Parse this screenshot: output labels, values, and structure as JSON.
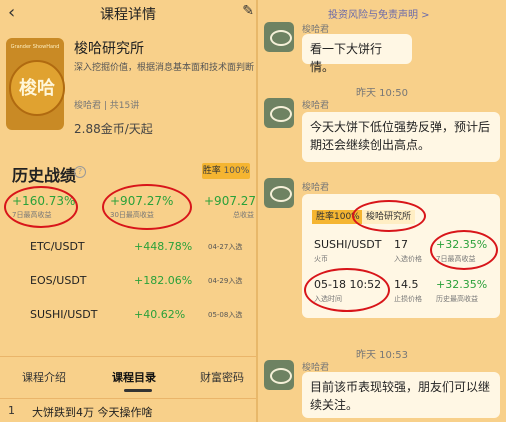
{
  "left": {
    "header": {
      "back_icon": "chevron-left-icon",
      "title": "课程详情",
      "share_icon": "edit-icon"
    },
    "institute": {
      "logo_text": "梭哈",
      "logo_en": "Grander ShowHand",
      "name": "梭哈研究所",
      "description": "深入挖掘价值，根据消息基本面和技术面判断现货数字货币走势，通过优化达",
      "meta": "梭哈君 | 共15讲",
      "price": "2.88金币/天起"
    },
    "record": {
      "title": "历史战绩",
      "win_label": "胜率",
      "win_rate": "100%",
      "stats": [
        {
          "value": "+160.73%",
          "label": "7日最高收益"
        },
        {
          "value": "+907.27%",
          "label": "30日最高收益"
        },
        {
          "value": "+907.27%",
          "label": "总收益"
        }
      ],
      "rows": [
        {
          "symbol": "ETC/USDT",
          "gain": "+448.78%",
          "date": "04-27入选"
        },
        {
          "symbol": "EOS/USDT",
          "gain": "+182.06%",
          "date": "04-29入选"
        },
        {
          "symbol": "SUSHI/USDT",
          "gain": "+40.62%",
          "date": "05-08入选"
        }
      ]
    },
    "tabs": [
      "课程介绍",
      "课程目录",
      "财富密码"
    ],
    "active_tab": "课程目录",
    "first_lesson": {
      "num": "1",
      "title": "大饼跌到4万 今天操作啥"
    }
  },
  "right": {
    "disclaimer": "投资风险与免责声明 >",
    "messages": [
      {
        "sender": "梭哈君",
        "text": "看一下大饼行情。"
      },
      {
        "timestamp": "昨天 10:50"
      },
      {
        "sender": "梭哈君",
        "text": "今天大饼下低位强势反弹，预计后期还会继续创出高点。"
      },
      {
        "sender": "梭哈君",
        "card": {
          "win_badge": "胜率100%",
          "inst_badge": "梭哈研究所",
          "symbol": "SUSHI/USDT",
          "sub_symbol": "火币",
          "entry_price": "17",
          "entry_price_label": "入选价格",
          "gain7": "+32.35%",
          "gain7_label": "7日最高收益",
          "entry_time": "05-18 10:52",
          "entry_time_label": "入选时间",
          "stop_price": "14.5",
          "stop_price_label": "止损价格",
          "hist_gain": "+32.35%",
          "hist_gain_label": "历史最高收益"
        }
      },
      {
        "timestamp": "昨天 10:53"
      },
      {
        "sender": "梭哈君",
        "text": "目前该币表现较强，朋友们可以继续关注。"
      }
    ]
  },
  "colors": {
    "background": "#f8d08a",
    "gain_green": "#2aa13a",
    "highlight_red": "#d8151a",
    "badge_orange": "#f5b531"
  }
}
